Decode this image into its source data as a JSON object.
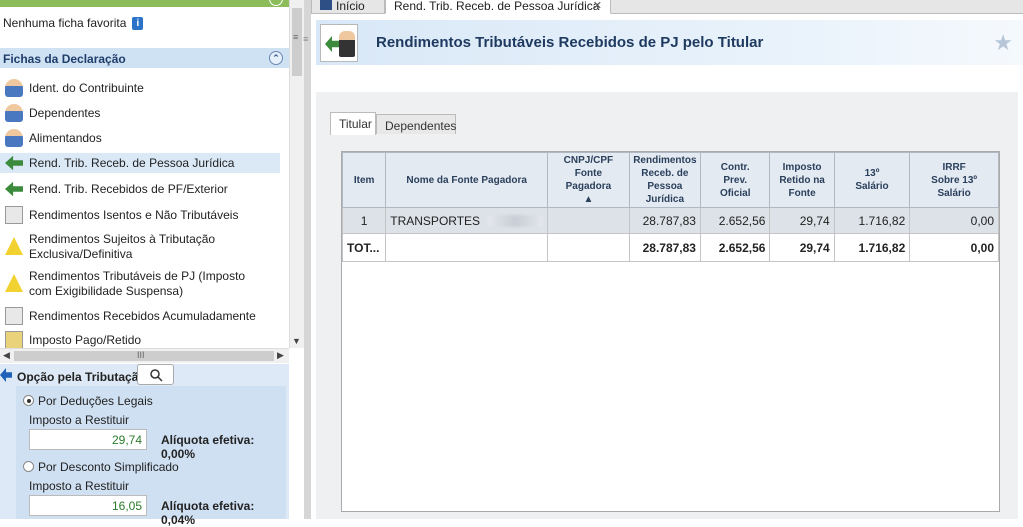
{
  "favoritos": {
    "empty": "Nenhuma ficha favorita"
  },
  "fichas": {
    "header": "Fichas da Declaração",
    "items": [
      {
        "label": "Ident. do Contribuinte",
        "icon": "person-icon"
      },
      {
        "label": "Dependentes",
        "icon": "dependents-icon"
      },
      {
        "label": "Alimentandos",
        "icon": "alimentandos-icon"
      },
      {
        "label": "Rend. Trib. Receb. de Pessoa Jurídica",
        "icon": "pj-income-icon",
        "selected": true
      },
      {
        "label": "Rend. Trib. Recebidos de PF/Exterior",
        "icon": "pf-income-icon"
      },
      {
        "label": "Rendimentos Isentos e Não Tributáveis",
        "icon": "exempt-doc-icon"
      },
      {
        "label": "Rendimentos Sujeitos à Tributação Exclusiva/Definitiva",
        "icon": "warning-icon"
      },
      {
        "label": "Rendimentos Tributáveis de PJ (Imposto com Exigibilidade Suspensa)",
        "icon": "suspended-tax-icon"
      },
      {
        "label": "Rendimentos Recebidos Acumuladamente",
        "icon": "accumulated-icon"
      },
      {
        "label": "Imposto Pago/Retido",
        "icon": "tax-paid-icon"
      }
    ]
  },
  "opcao": {
    "label": "Opção pela Tributação:",
    "deducoes": {
      "label": "Por Deduções Legais",
      "sub": "Imposto a Restituir",
      "value": "29,74",
      "aliquota": "Alíquota efetiva: 0,00%"
    },
    "simplificado": {
      "label": "Por Desconto Simplificado",
      "sub": "Imposto a Restituir",
      "value": "16,05",
      "aliquota": "Alíquota efetiva: 0,04%"
    }
  },
  "tabs": {
    "inicio": "Início",
    "active": "Rend. Trib. Receb. de Pessoa Jurídica"
  },
  "page": {
    "title": "Rendimentos Tributáveis Recebidos de PJ pelo Titular"
  },
  "subtabs": {
    "titular": "Titular",
    "dependentes": "Dependentes"
  },
  "table": {
    "headers": [
      "Item",
      "Nome da Fonte Pagadora",
      "CNPJ/CPF Fonte Pagadora",
      "Rendimentos Receb. de Pessoa Jurídica",
      "Contr. Prev. Oficial",
      "Imposto Retido na Fonte",
      "13º Salário",
      "IRRF Sobre 13º Salário"
    ],
    "rows": [
      {
        "item": "1",
        "nome": "TRANSPORTES",
        "cnpj": "",
        "rend": "28.787,83",
        "contr": "2.652,56",
        "imposto": "29,74",
        "decimo": "1.716,82",
        "irrf": "0,00"
      }
    ],
    "total": {
      "item": "TOT...",
      "nome": "",
      "cnpj": "",
      "rend": "28.787,83",
      "contr": "2.652,56",
      "imposto": "29,74",
      "decimo": "1.716,82",
      "irrf": "0,00"
    }
  }
}
